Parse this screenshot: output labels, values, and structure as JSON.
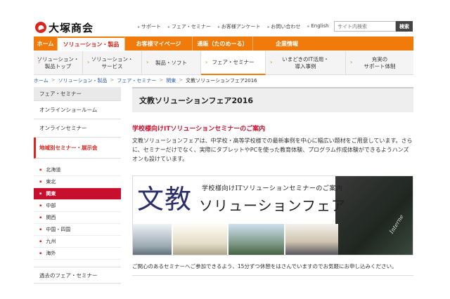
{
  "header": {
    "logo_text": "大塚商会",
    "util_links": [
      "サポート",
      "フェア・セミナー",
      "お客様アンケート",
      "お問い合わせ",
      "English"
    ],
    "search_placeholder": "サイト内検索",
    "search_button": "検索"
  },
  "gnav": {
    "home": "ホーム",
    "solution": "ソリューション・製品",
    "mypage": "お客様マイページ",
    "tsuhan": "通販（たのめーる）",
    "corp": "企業情報"
  },
  "subnav": {
    "items": [
      {
        "line1": "ソリューション・",
        "line2": "製品トップ"
      },
      {
        "line1": "ソリューション・",
        "line2": "サービス"
      },
      {
        "line1": "製品・ソフト",
        "line2": ""
      },
      {
        "line1": "フェア・セミナー",
        "line2": ""
      },
      {
        "line1": "いまどきのIT活用・",
        "line2": "導入事例"
      },
      {
        "line1": "充実の",
        "line2": "サポート体制"
      }
    ]
  },
  "breadcrumb": [
    "ホーム",
    "ソリューション・製品",
    "フェア・セミナー",
    "関東",
    "文教ソリューションフェア2016"
  ],
  "sidebar": {
    "head": "フェア・セミナー",
    "items": [
      "オンラインショールーム",
      "オンラインセミナー"
    ],
    "current": "地域別セミナー・展示会",
    "regions": [
      "北海道",
      "東北",
      "関東",
      "中部",
      "関西",
      "中国・四国",
      "九州",
      "海外"
    ],
    "past": "過去のフェア・セミナー"
  },
  "main": {
    "title": "文教ソリューションフェア2016",
    "section_heading": "学校様向けITソリューションセミナーのご案内",
    "lead": "文教ソリューションフェアは、中学校・高等学校様での最新事例を中心に幅広い題材をご用意しています。さらに、セミナーだけでなく、実際にタブレットやPCを使った教育体験、プログラム作成体験ができるようハンズオンも設けています。",
    "banner": {
      "big": "文教",
      "sub": "学校様向けITソリューションセミナーのご案内",
      "title": "ソリューションフェア",
      "chalk": "Interne"
    },
    "footnote": "ご関心のあるセミナーへご参加できるよう、15分ずつ休憩をはさんでいますのでお気軽にお申し込みください。"
  },
  "colors": {
    "brand_red": "#d9251d",
    "nav_orange": "#f07a0a",
    "active_region": "#c8102e"
  }
}
